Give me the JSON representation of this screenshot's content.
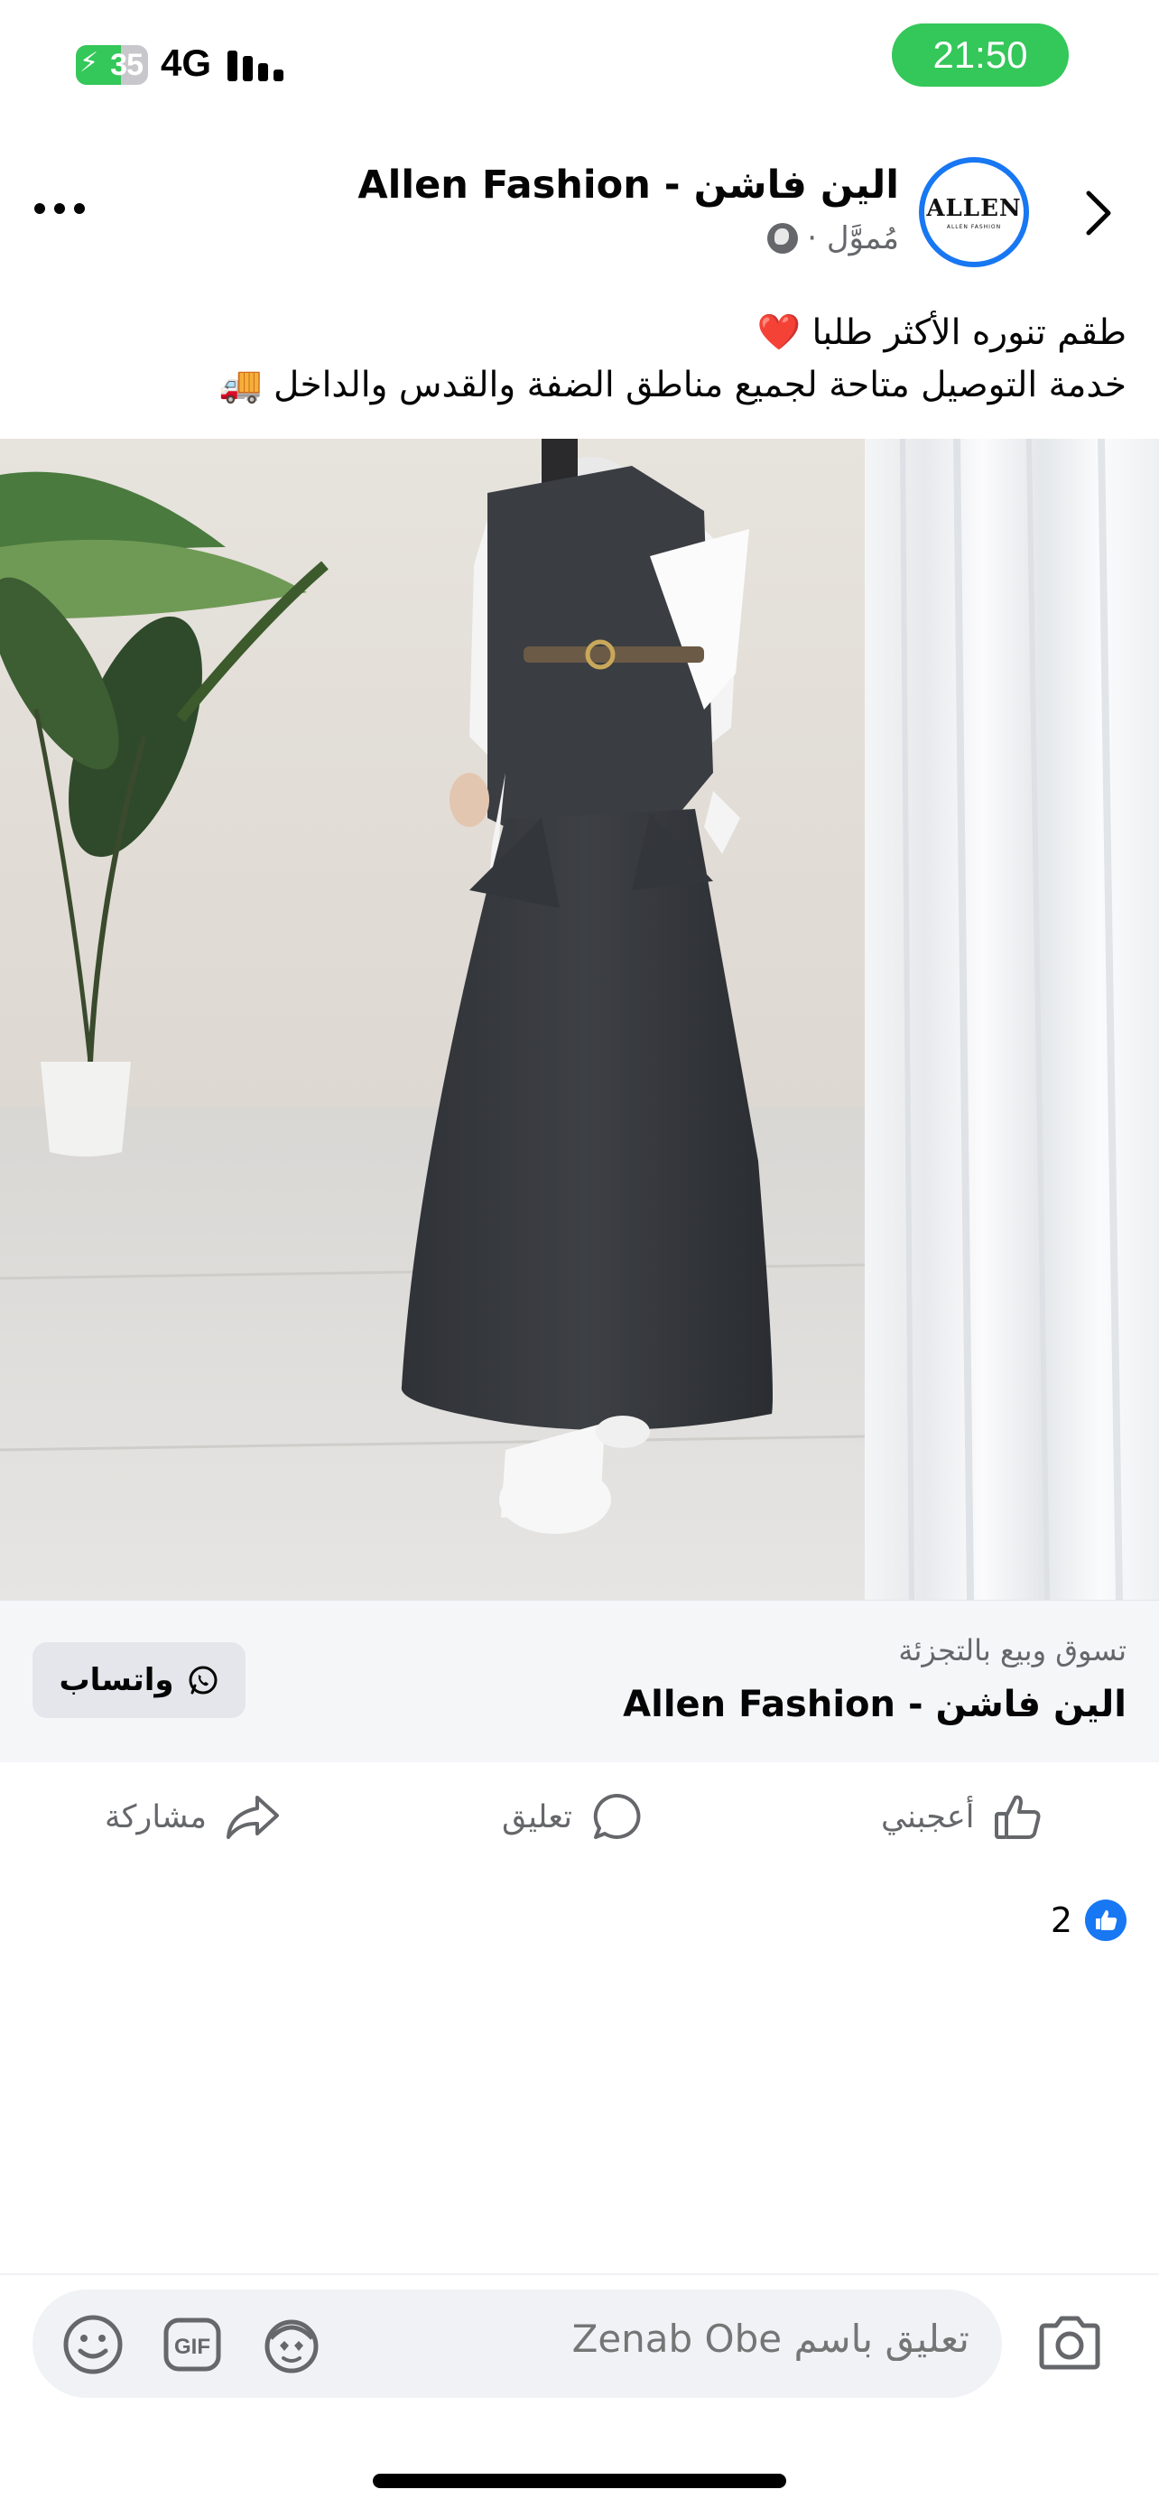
{
  "status_bar": {
    "battery_level": "35",
    "network": "4G",
    "time": "21:50",
    "colors": {
      "battery": "#34c759",
      "time_pill": "#34c759"
    }
  },
  "post": {
    "page_name": "الين فاشن - Allen Fashion",
    "sponsored_label": "مُموَّل ·",
    "caption_line_1": "طقم تنوره الأكثر طلبا ❤️",
    "caption_line_2": "خدمة التوصيل متاحة لجميع مناطق الضفة والقدس والداخل 🚚",
    "avatar_logo": "ALLEN",
    "avatar_sub": "ALLEN FASHION"
  },
  "cta": {
    "subtitle": "تسوق وبيع بالتجزئة",
    "title": "الين فاشن - Allen Fashion",
    "button_label": "واتساب"
  },
  "actions": {
    "like": "أعجبني",
    "comment": "تعليق",
    "share": "مشاركة"
  },
  "reactions": {
    "count": "2"
  },
  "composer": {
    "placeholder": "تعليق باسم Zenab Obe"
  },
  "icons": {
    "back": "chevron-right-icon",
    "more": "more-horizontal-icon",
    "globe": "globe-icon",
    "whatsapp": "whatsapp-icon",
    "like": "thumbs-up-icon",
    "comment": "comment-bubble-icon",
    "share": "share-arrow-icon",
    "emoji": "emoji-icon",
    "gif": "gif-icon",
    "avatar_sticker": "avatar-sticker-icon",
    "camera": "camera-icon"
  },
  "colors": {
    "accent": "#1877f2",
    "secondary_text": "#65676b",
    "cta_background": "#f5f6f8"
  }
}
